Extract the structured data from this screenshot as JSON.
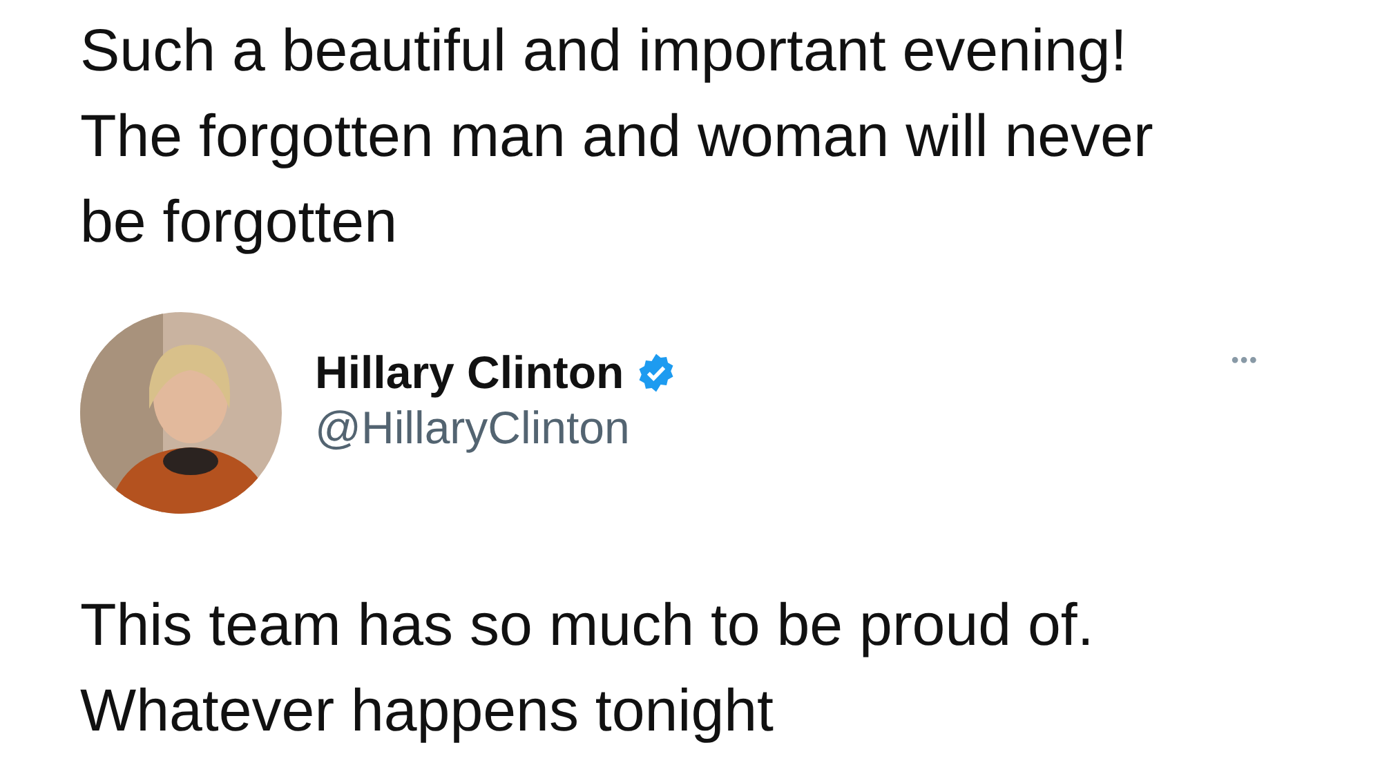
{
  "quoted_text": "Such a beautiful and important evening! The forgotten man and woman will never be forgotten",
  "tweet": {
    "name": "Hillary Clinton",
    "verified": true,
    "handle": "@HillaryClinton",
    "more": "•••",
    "text": "This team has so much to be proud of. Whatever happens tonight"
  }
}
